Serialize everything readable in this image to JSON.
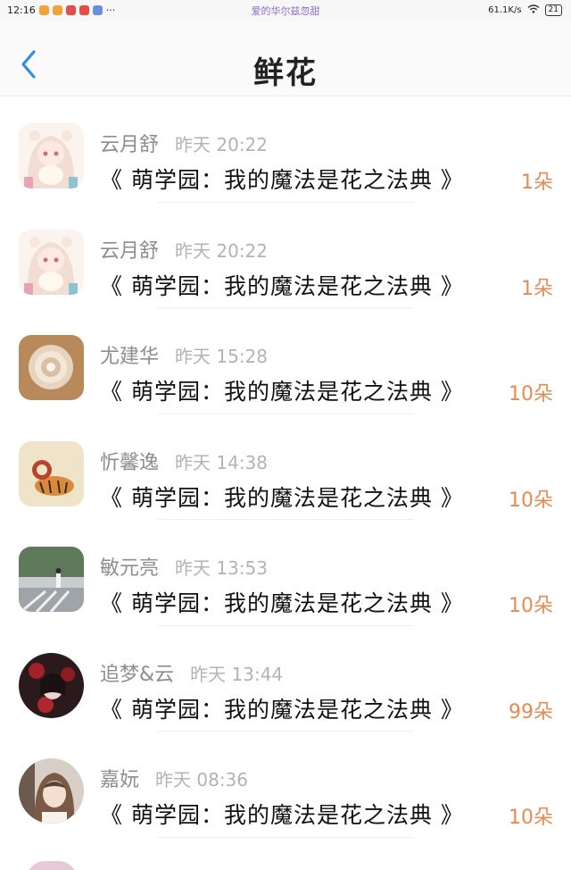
{
  "status_bar": {
    "time": "12:16",
    "dots": "···",
    "center_text": "爱的华尔兹忽甜",
    "network_speed": "61.1K/s",
    "battery": "21"
  },
  "header": {
    "title": "鲜花"
  },
  "colors": {
    "accent_blue": "#2f8fe8",
    "count_orange": "#e58b53",
    "name_gray": "#8d8d8d",
    "time_gray": "#b3b3b3"
  },
  "records": [
    {
      "name": "云月舒",
      "time": "昨天 20:22",
      "book": "《 萌学园：我的魔法是花之法典 》",
      "count": "1朵",
      "avatar": "anime-girl-bear-avatar"
    },
    {
      "name": "云月舒",
      "time": "昨天 20:22",
      "book": "《 萌学园：我的魔法是花之法典 》",
      "count": "1朵",
      "avatar": "anime-girl-bear-avatar"
    },
    {
      "name": "尤建华",
      "time": "昨天 15:28",
      "book": "《 萌学园：我的魔法是花之法典 》",
      "count": "10朵",
      "avatar": "crystal-avatar"
    },
    {
      "name": "忻馨逸",
      "time": "昨天 14:38",
      "book": "《 萌学园：我的魔法是花之法典 》",
      "count": "10朵",
      "avatar": "cartoon-tiger-avatar"
    },
    {
      "name": "敏元亮",
      "time": "昨天 13:53",
      "book": "《 萌学园：我的魔法是花之法典 》",
      "count": "10朵",
      "avatar": "street-photo-avatar"
    },
    {
      "name": "追梦&云",
      "time": "昨天 13:44",
      "book": "《 萌学园：我的魔法是花之法典 》",
      "count": "99朵",
      "avatar": "dark-anime-avatar"
    },
    {
      "name": "嘉妧",
      "time": "昨天 08:36",
      "book": "《 萌学园：我的魔法是花之法典 》",
      "count": "10朵",
      "avatar": "photo-girl-avatar"
    }
  ]
}
